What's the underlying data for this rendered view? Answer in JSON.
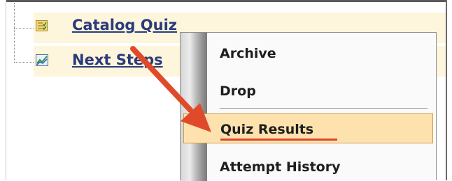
{
  "tree": {
    "items": [
      {
        "label": "Catalog Quiz",
        "icon": "quiz-checklist-icon"
      },
      {
        "label": "Next Steps",
        "icon": "chart-icon"
      }
    ]
  },
  "context_menu": {
    "items": [
      {
        "label": "Archive"
      },
      {
        "label": "Drop"
      },
      {
        "label": "Quiz Results",
        "selected": true
      },
      {
        "label": "Attempt History"
      }
    ]
  },
  "annotation": {
    "icon": "red-arrow-icon",
    "color": "#e04a2a"
  },
  "colors": {
    "row_highlight": "#fdf6dc",
    "link": "#2a3a7a",
    "menu_selected": "#fde2ae"
  }
}
